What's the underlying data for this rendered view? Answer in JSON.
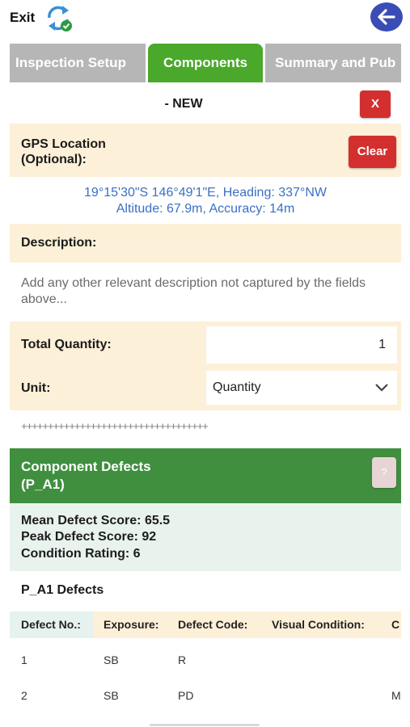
{
  "topbar": {
    "exit_label": "Exit",
    "sync_icon": "sync-check-icon",
    "back_icon": "arrow-left-icon",
    "back_color": "#3a4db5"
  },
  "tabs": [
    {
      "label": "Inspection Setup",
      "active": false
    },
    {
      "label": "Components",
      "active": true
    },
    {
      "label": "Summary and Pub",
      "active": false
    }
  ],
  "form": {
    "title": "- NEW",
    "close_label": "X",
    "gps": {
      "label_line1": "GPS Location",
      "label_line2": "(Optional):",
      "clear_label": "Clear",
      "readout_line1": "19°15'30\"S 146°49'1\"E, Heading: 337°NW",
      "readout_line2": "Altitude: 67.9m, Accuracy: 14m"
    },
    "description": {
      "label": "Description:",
      "placeholder": "Add any other relevant description not captured by the fields above..."
    },
    "quantity": {
      "label": "Total Quantity:",
      "value": "1"
    },
    "unit": {
      "label": "Unit:",
      "selected": "Quantity"
    },
    "separator": "+++++++++++++++++++++++++++++++++++"
  },
  "defects": {
    "header_line1": "Component Defects",
    "header_line2": "(P_A1)",
    "help_label": "?",
    "mean_score": "Mean Defect Score: 65.5",
    "peak_score": "Peak Defect Score: 92",
    "condition_rating": "Condition Rating: 6",
    "sub_title": "P_A1 Defects",
    "columns": [
      "Defect No.:",
      "Exposure:",
      "Defect Code:",
      "Visual Condition:",
      "C"
    ],
    "rows": [
      [
        "1",
        "SB",
        "R",
        "",
        ""
      ],
      [
        "2",
        "SB",
        "PD",
        "",
        "M"
      ]
    ]
  },
  "colors": {
    "accent_green": "#4aa82b",
    "header_green": "#3f8f3f",
    "danger_red": "#d32f2f",
    "panel_cream": "#fdf0d8",
    "link_blue": "#3b6fc4"
  }
}
